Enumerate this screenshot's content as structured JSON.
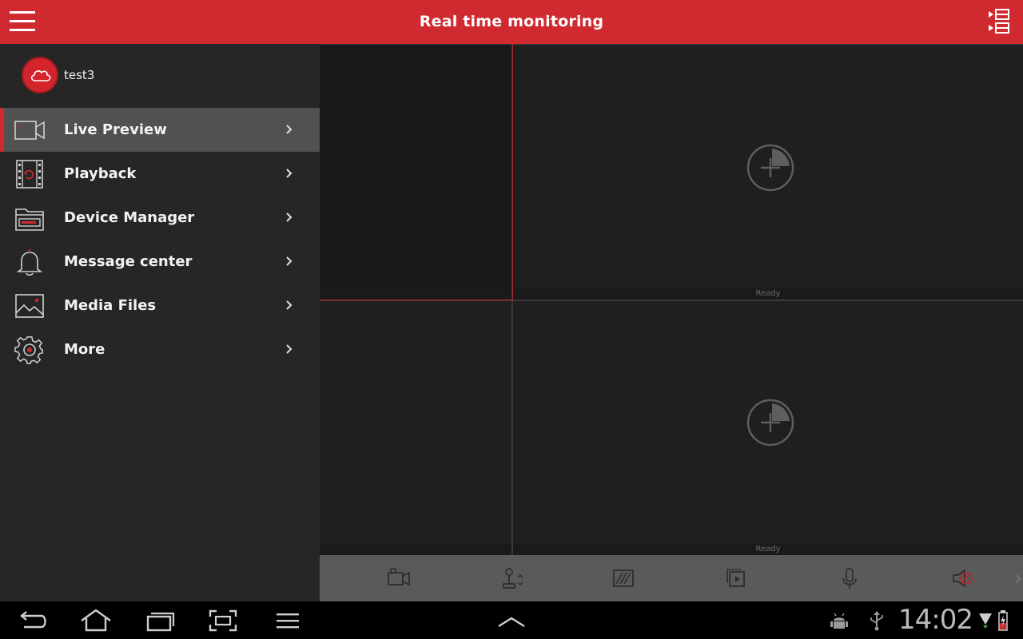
{
  "header": {
    "title": "Real time monitoring",
    "menu_icon": "hamburger-icon",
    "layout_icon": "split-layout-icon"
  },
  "drawer": {
    "user": {
      "name": "test3",
      "avatar_icon": "cloud-icon"
    },
    "items": [
      {
        "label": "Live Preview",
        "icon": "video-camera-icon",
        "active": true
      },
      {
        "label": "Playback",
        "icon": "film-playback-icon",
        "active": false
      },
      {
        "label": "Device Manager",
        "icon": "dvr-device-icon",
        "active": false
      },
      {
        "label": "Message center",
        "icon": "bell-icon",
        "active": false
      },
      {
        "label": "Media Files",
        "icon": "image-icon",
        "active": false
      },
      {
        "label": "More",
        "icon": "gear-icon",
        "active": false
      }
    ]
  },
  "video_grid": {
    "panes": [
      {
        "status": ""
      },
      {
        "status": "Ready"
      },
      {
        "status": ""
      },
      {
        "status": "Ready"
      }
    ]
  },
  "toolbar": {
    "tools": [
      "record-icon",
      "ptz-control-icon",
      "image-quality-icon",
      "screenshot-playback-icon",
      "microphone-icon",
      "mute-icon"
    ]
  },
  "system_bar": {
    "time": "14:02"
  },
  "colors": {
    "accent": "#cf2a30",
    "drawer_bg": "#262626",
    "active_item_bg": "#515151",
    "pane_bg": "#1f1f1f",
    "toolbar_bg": "#5a5a5a"
  }
}
